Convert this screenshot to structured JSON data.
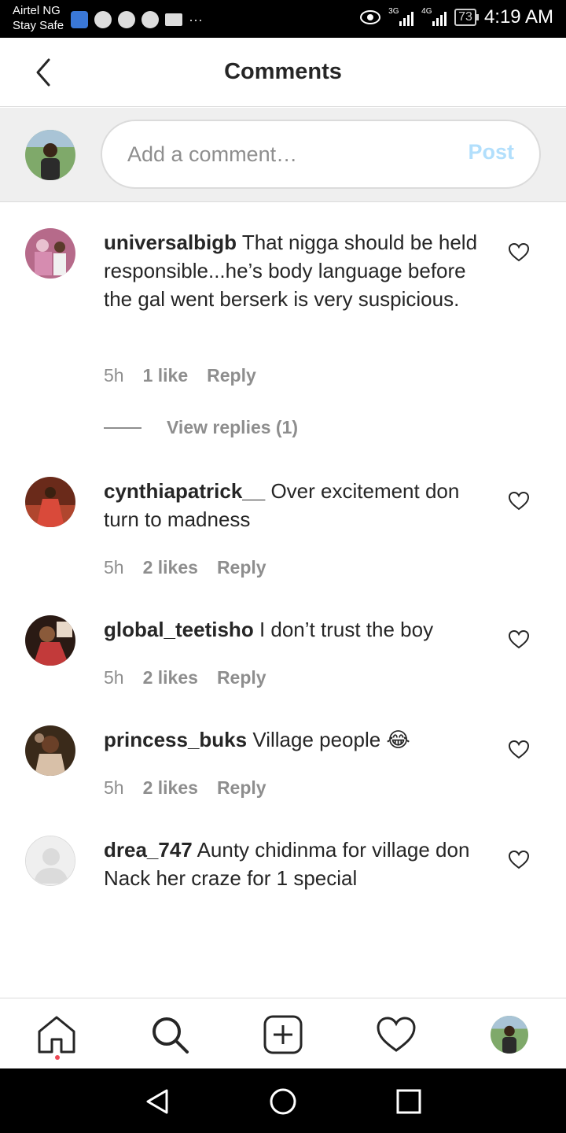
{
  "status_bar": {
    "carrier": "Airtel NG",
    "carrier_sub": "Stay Safe",
    "net_3g": "3G",
    "net_4g": "4G",
    "battery": "73",
    "time": "4:19 AM",
    "more": "···"
  },
  "header": {
    "title": "Comments"
  },
  "composer": {
    "placeholder": "Add a comment…",
    "post_label": "Post",
    "post_color": "#b2dffc"
  },
  "comments": [
    {
      "username": "universalbigb",
      "text": "That nigga should be held responsible...he’s body language before the gal went berserk is very suspicious.",
      "time": "5h",
      "likes": "1 like",
      "reply": "Reply",
      "view_replies": "View replies (1)"
    },
    {
      "username": "cynthiapatrick__",
      "text": "Over excitement don turn to madness",
      "time": "5h",
      "likes": "2 likes",
      "reply": "Reply"
    },
    {
      "username": "global_teetisho",
      "text": "I don’t trust the boy",
      "time": "5h",
      "likes": "2 likes",
      "reply": "Reply"
    },
    {
      "username": "princess_buks",
      "text": "Village people 😂",
      "time": "5h",
      "likes": "2 likes",
      "reply": "Reply"
    },
    {
      "username": "drea_747",
      "text": "Aunty chidinma for village don Nack her craze for 1 special"
    }
  ],
  "colors": {
    "text": "#262626",
    "muted": "#8e8e8e",
    "divider": "#dbdbdb",
    "composer_bg": "#efefef",
    "notification_dot": "#ed4956"
  },
  "bottom_nav": [
    "home-icon",
    "search-icon",
    "new-post-icon",
    "activity-heart-icon",
    "profile-avatar"
  ],
  "system_nav": [
    "back-triangle-icon",
    "home-circle-icon",
    "recents-square-icon"
  ]
}
